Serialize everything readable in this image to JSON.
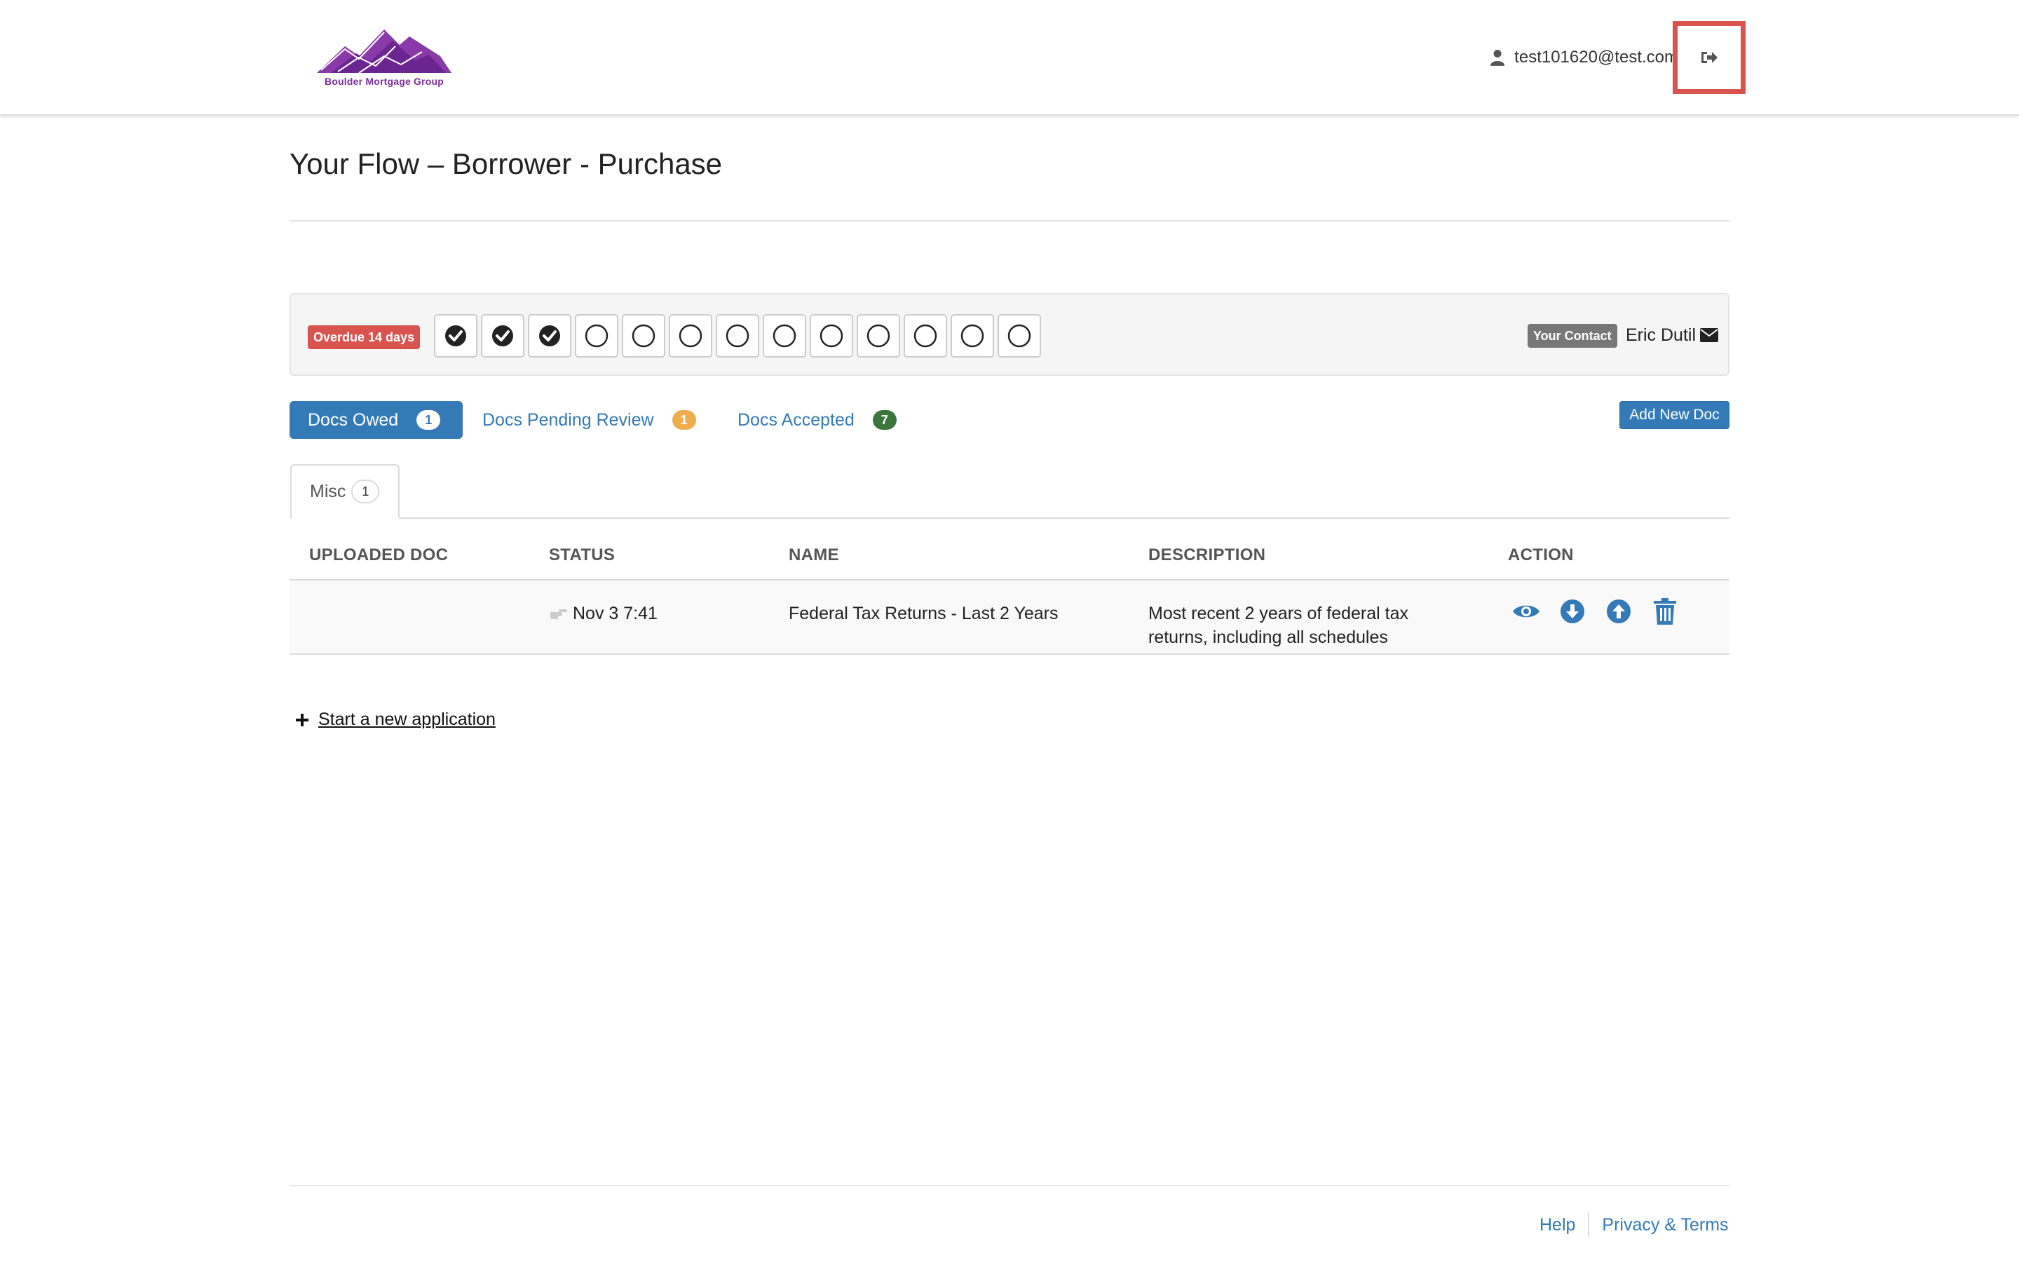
{
  "header": {
    "logo_text": "Boulder Mortgage Group",
    "user_email": "test101620@test.com",
    "user_icon": "user-icon",
    "logout_icon": "sign-out-icon"
  },
  "page": {
    "title": "Your Flow – Borrower - Purchase"
  },
  "progress": {
    "overdue_label": "Overdue 14 days",
    "steps": [
      "done",
      "done",
      "done",
      "pending",
      "pending",
      "pending",
      "pending",
      "pending",
      "pending",
      "pending",
      "pending",
      "pending",
      "pending"
    ],
    "contact_badge": "Your Contact",
    "contact_name": "Eric Dutil",
    "contact_icon": "envelope-icon"
  },
  "tabs": {
    "docs_owed": {
      "label": "Docs Owed",
      "count": "1"
    },
    "docs_pending": {
      "label": "Docs Pending Review",
      "count": "1"
    },
    "docs_accepted": {
      "label": "Docs Accepted",
      "count": "7"
    },
    "add_new_doc": "Add New Doc"
  },
  "subtab": {
    "label": "Misc",
    "count": "1"
  },
  "table": {
    "columns": [
      "UPLOADED DOC",
      "STATUS",
      "NAME",
      "DESCRIPTION",
      "ACTION"
    ],
    "rows": [
      {
        "uploaded_doc": "",
        "status": "Nov 3 7:41",
        "name": "Federal Tax Returns - Last 2 Years",
        "description": "Most recent 2 years of federal tax returns, including all schedules",
        "actions": [
          "eye-icon",
          "download-icon",
          "upload-icon",
          "trash-icon"
        ]
      }
    ]
  },
  "new_application": "Start a new application",
  "footer": {
    "help": "Help",
    "privacy": "Privacy & Terms"
  },
  "colors": {
    "primary": "#337ab7",
    "danger": "#d9534f",
    "warning": "#f0ad4e",
    "success": "#3c763d",
    "logo_purple": "#7b2e9c"
  }
}
